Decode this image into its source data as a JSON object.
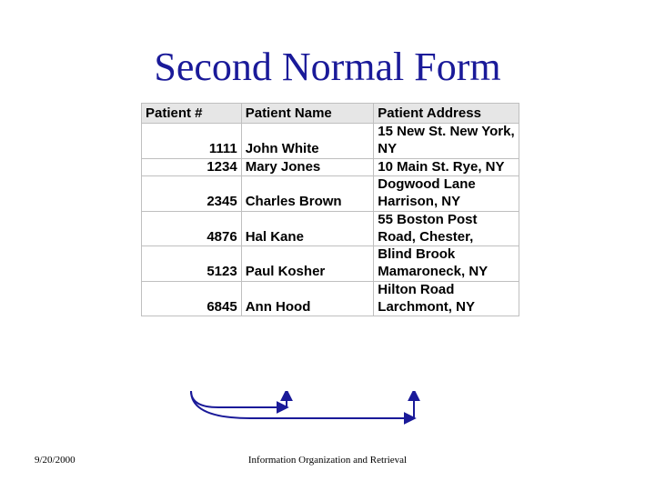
{
  "title": "Second Normal Form",
  "columns": [
    "Patient #",
    "Patient Name",
    "Patient Address"
  ],
  "rows": [
    {
      "num": "1111",
      "name": "John White",
      "address": "15 New St. New York, NY"
    },
    {
      "num": "1234",
      "name": "Mary Jones",
      "address": "10 Main St. Rye, NY"
    },
    {
      "num": "2345",
      "name": "Charles Brown",
      "address": "Dogwood Lane Harrison, NY"
    },
    {
      "num": "4876",
      "name": "Hal Kane",
      "address": "55 Boston Post Road, Chester,"
    },
    {
      "num": "5123",
      "name": "Paul Kosher",
      "address": "Blind Brook Mamaroneck, NY"
    },
    {
      "num": "6845",
      "name": "Ann Hood",
      "address": "Hilton Road Larchmont, NY"
    }
  ],
  "footer": {
    "date": "9/20/2000",
    "center": "Information Organization and Retrieval"
  }
}
